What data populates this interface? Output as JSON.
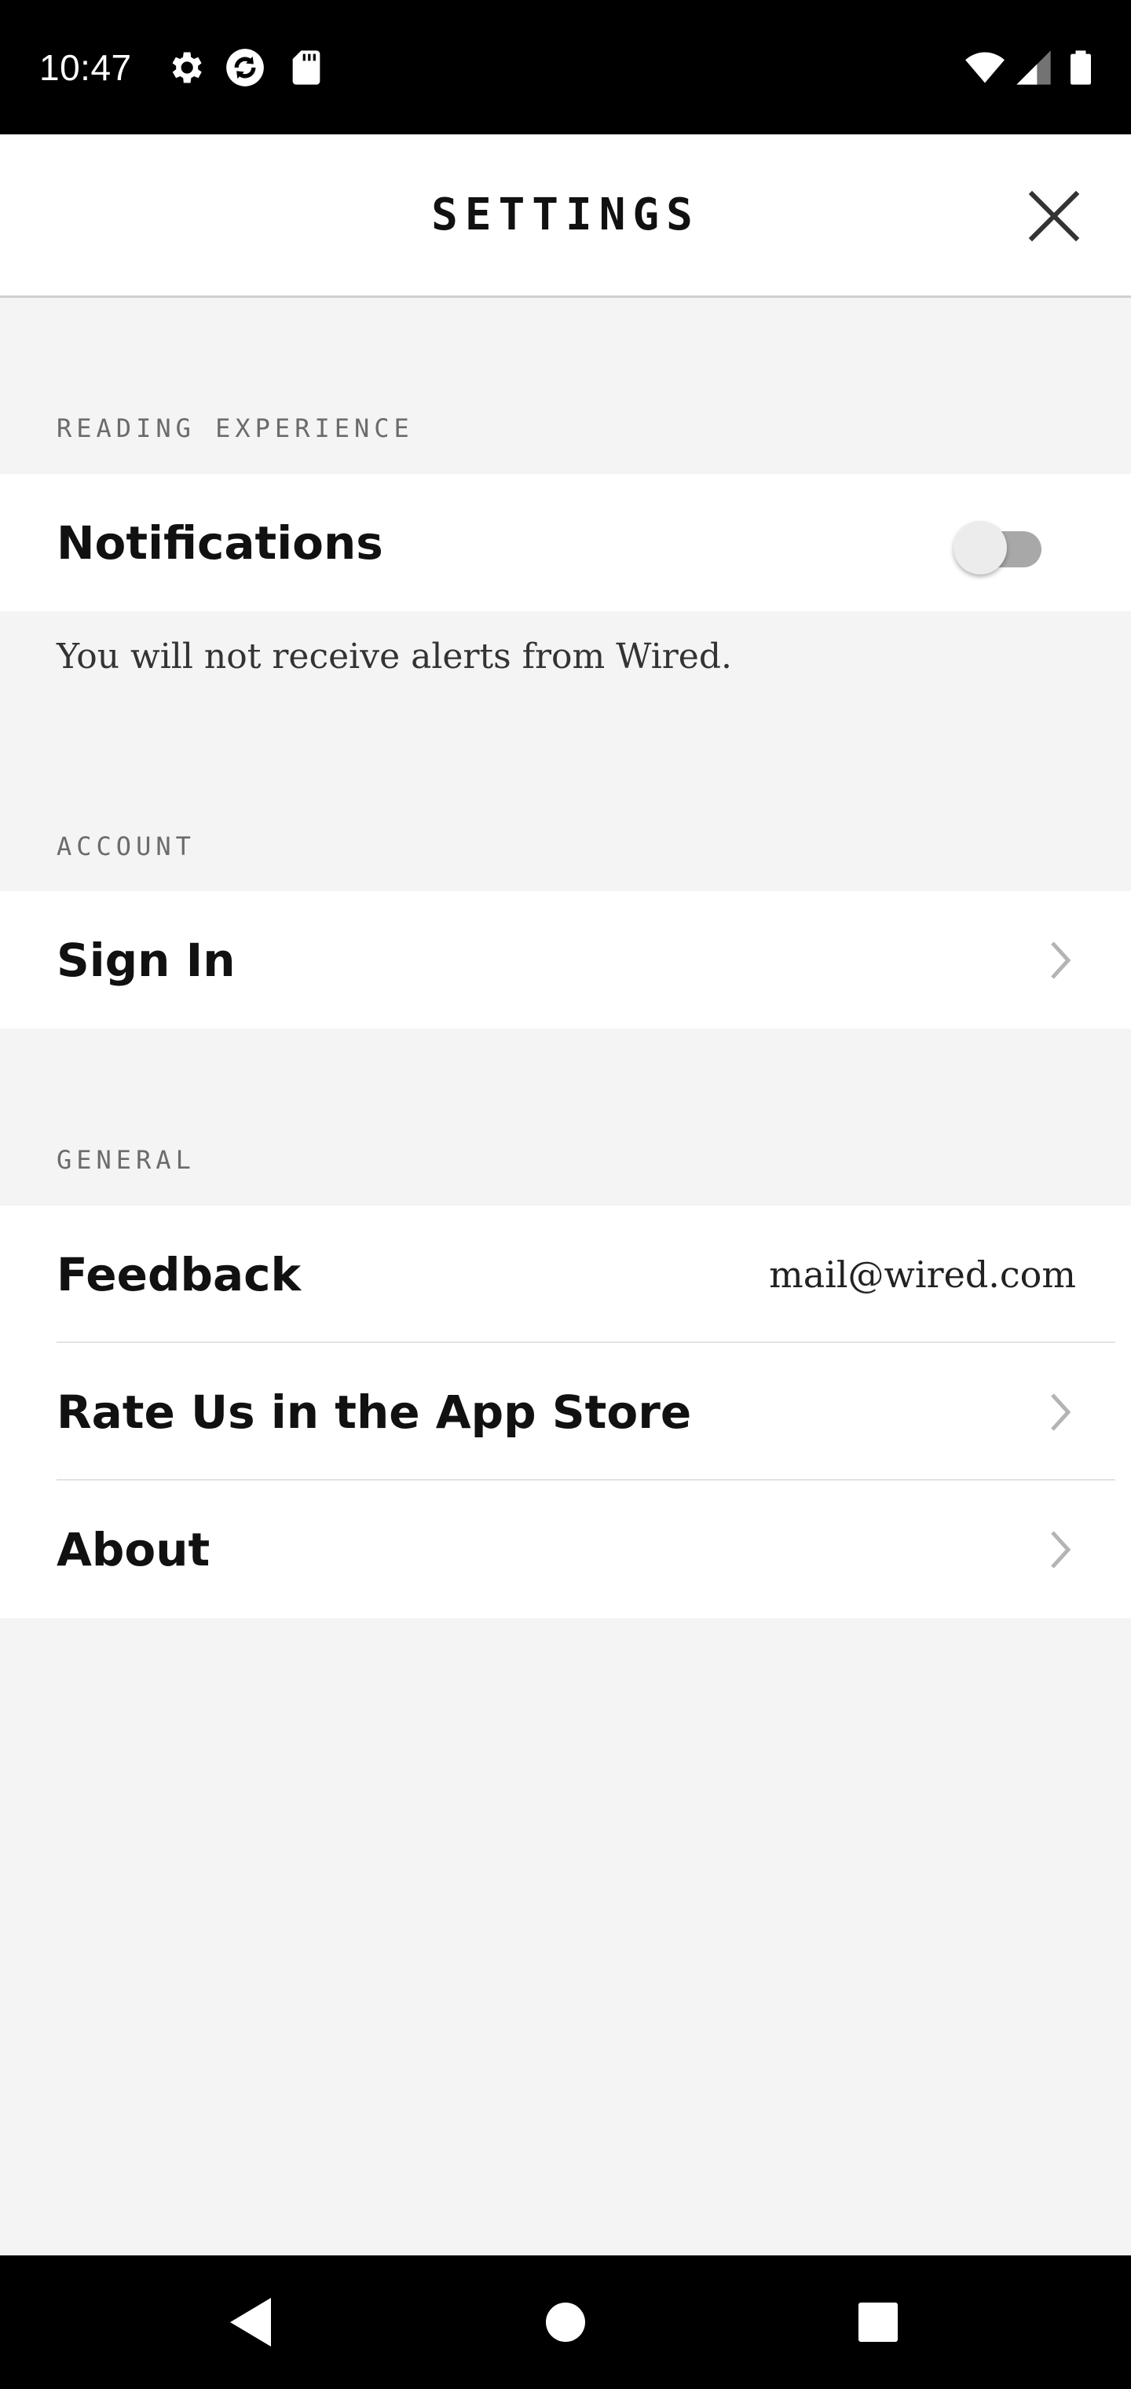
{
  "status_bar": {
    "time": "10:47",
    "icons": [
      "gear-icon",
      "sync-icon",
      "sd-card-icon",
      "wifi-icon",
      "cell-signal-icon",
      "battery-icon"
    ]
  },
  "header": {
    "title": "SETTINGS",
    "close_icon": "close-icon"
  },
  "sections": {
    "reading_experience": {
      "title": "READING EXPERIENCE",
      "notifications_label": "Notifications",
      "notifications_enabled": false,
      "helper_text": "You will not receive alerts from Wired."
    },
    "account": {
      "title": "ACCOUNT",
      "sign_in_label": "Sign In"
    },
    "general": {
      "title": "GENERAL",
      "feedback_label": "Feedback",
      "feedback_value": "mail@wired.com",
      "rate_label": "Rate Us in the App Store",
      "about_label": "About"
    }
  },
  "nav_bar": {
    "icons": [
      "back-icon",
      "home-icon",
      "recents-icon"
    ]
  },
  "colors": {
    "background": "#f4f4f4",
    "row_background": "#ffffff",
    "bars": "#000000"
  }
}
